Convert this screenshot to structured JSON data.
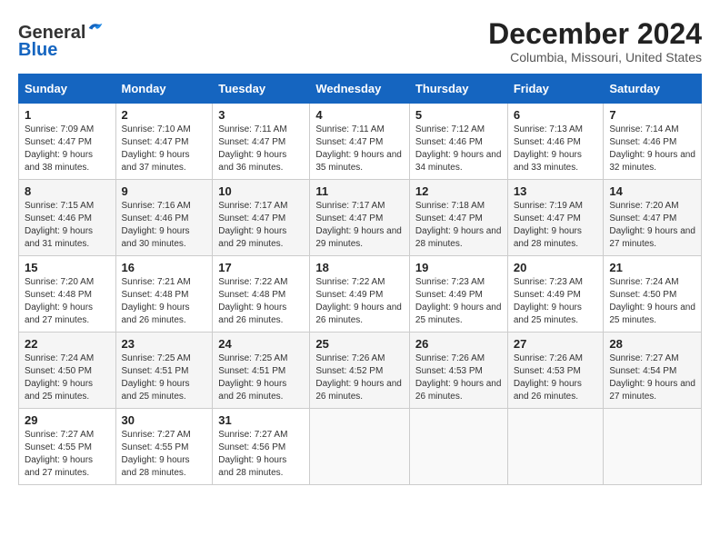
{
  "logo": {
    "line1": "General",
    "line2": "Blue"
  },
  "title": "December 2024",
  "subtitle": "Columbia, Missouri, United States",
  "weekdays": [
    "Sunday",
    "Monday",
    "Tuesday",
    "Wednesday",
    "Thursday",
    "Friday",
    "Saturday"
  ],
  "weeks": [
    [
      {
        "day": "1",
        "sunrise": "Sunrise: 7:09 AM",
        "sunset": "Sunset: 4:47 PM",
        "daylight": "Daylight: 9 hours and 38 minutes."
      },
      {
        "day": "2",
        "sunrise": "Sunrise: 7:10 AM",
        "sunset": "Sunset: 4:47 PM",
        "daylight": "Daylight: 9 hours and 37 minutes."
      },
      {
        "day": "3",
        "sunrise": "Sunrise: 7:11 AM",
        "sunset": "Sunset: 4:47 PM",
        "daylight": "Daylight: 9 hours and 36 minutes."
      },
      {
        "day": "4",
        "sunrise": "Sunrise: 7:11 AM",
        "sunset": "Sunset: 4:47 PM",
        "daylight": "Daylight: 9 hours and 35 minutes."
      },
      {
        "day": "5",
        "sunrise": "Sunrise: 7:12 AM",
        "sunset": "Sunset: 4:46 PM",
        "daylight": "Daylight: 9 hours and 34 minutes."
      },
      {
        "day": "6",
        "sunrise": "Sunrise: 7:13 AM",
        "sunset": "Sunset: 4:46 PM",
        "daylight": "Daylight: 9 hours and 33 minutes."
      },
      {
        "day": "7",
        "sunrise": "Sunrise: 7:14 AM",
        "sunset": "Sunset: 4:46 PM",
        "daylight": "Daylight: 9 hours and 32 minutes."
      }
    ],
    [
      {
        "day": "8",
        "sunrise": "Sunrise: 7:15 AM",
        "sunset": "Sunset: 4:46 PM",
        "daylight": "Daylight: 9 hours and 31 minutes."
      },
      {
        "day": "9",
        "sunrise": "Sunrise: 7:16 AM",
        "sunset": "Sunset: 4:46 PM",
        "daylight": "Daylight: 9 hours and 30 minutes."
      },
      {
        "day": "10",
        "sunrise": "Sunrise: 7:17 AM",
        "sunset": "Sunset: 4:47 PM",
        "daylight": "Daylight: 9 hours and 29 minutes."
      },
      {
        "day": "11",
        "sunrise": "Sunrise: 7:17 AM",
        "sunset": "Sunset: 4:47 PM",
        "daylight": "Daylight: 9 hours and 29 minutes."
      },
      {
        "day": "12",
        "sunrise": "Sunrise: 7:18 AM",
        "sunset": "Sunset: 4:47 PM",
        "daylight": "Daylight: 9 hours and 28 minutes."
      },
      {
        "day": "13",
        "sunrise": "Sunrise: 7:19 AM",
        "sunset": "Sunset: 4:47 PM",
        "daylight": "Daylight: 9 hours and 28 minutes."
      },
      {
        "day": "14",
        "sunrise": "Sunrise: 7:20 AM",
        "sunset": "Sunset: 4:47 PM",
        "daylight": "Daylight: 9 hours and 27 minutes."
      }
    ],
    [
      {
        "day": "15",
        "sunrise": "Sunrise: 7:20 AM",
        "sunset": "Sunset: 4:48 PM",
        "daylight": "Daylight: 9 hours and 27 minutes."
      },
      {
        "day": "16",
        "sunrise": "Sunrise: 7:21 AM",
        "sunset": "Sunset: 4:48 PM",
        "daylight": "Daylight: 9 hours and 26 minutes."
      },
      {
        "day": "17",
        "sunrise": "Sunrise: 7:22 AM",
        "sunset": "Sunset: 4:48 PM",
        "daylight": "Daylight: 9 hours and 26 minutes."
      },
      {
        "day": "18",
        "sunrise": "Sunrise: 7:22 AM",
        "sunset": "Sunset: 4:49 PM",
        "daylight": "Daylight: 9 hours and 26 minutes."
      },
      {
        "day": "19",
        "sunrise": "Sunrise: 7:23 AM",
        "sunset": "Sunset: 4:49 PM",
        "daylight": "Daylight: 9 hours and 25 minutes."
      },
      {
        "day": "20",
        "sunrise": "Sunrise: 7:23 AM",
        "sunset": "Sunset: 4:49 PM",
        "daylight": "Daylight: 9 hours and 25 minutes."
      },
      {
        "day": "21",
        "sunrise": "Sunrise: 7:24 AM",
        "sunset": "Sunset: 4:50 PM",
        "daylight": "Daylight: 9 hours and 25 minutes."
      }
    ],
    [
      {
        "day": "22",
        "sunrise": "Sunrise: 7:24 AM",
        "sunset": "Sunset: 4:50 PM",
        "daylight": "Daylight: 9 hours and 25 minutes."
      },
      {
        "day": "23",
        "sunrise": "Sunrise: 7:25 AM",
        "sunset": "Sunset: 4:51 PM",
        "daylight": "Daylight: 9 hours and 25 minutes."
      },
      {
        "day": "24",
        "sunrise": "Sunrise: 7:25 AM",
        "sunset": "Sunset: 4:51 PM",
        "daylight": "Daylight: 9 hours and 26 minutes."
      },
      {
        "day": "25",
        "sunrise": "Sunrise: 7:26 AM",
        "sunset": "Sunset: 4:52 PM",
        "daylight": "Daylight: 9 hours and 26 minutes."
      },
      {
        "day": "26",
        "sunrise": "Sunrise: 7:26 AM",
        "sunset": "Sunset: 4:53 PM",
        "daylight": "Daylight: 9 hours and 26 minutes."
      },
      {
        "day": "27",
        "sunrise": "Sunrise: 7:26 AM",
        "sunset": "Sunset: 4:53 PM",
        "daylight": "Daylight: 9 hours and 26 minutes."
      },
      {
        "day": "28",
        "sunrise": "Sunrise: 7:27 AM",
        "sunset": "Sunset: 4:54 PM",
        "daylight": "Daylight: 9 hours and 27 minutes."
      }
    ],
    [
      {
        "day": "29",
        "sunrise": "Sunrise: 7:27 AM",
        "sunset": "Sunset: 4:55 PM",
        "daylight": "Daylight: 9 hours and 27 minutes."
      },
      {
        "day": "30",
        "sunrise": "Sunrise: 7:27 AM",
        "sunset": "Sunset: 4:55 PM",
        "daylight": "Daylight: 9 hours and 28 minutes."
      },
      {
        "day": "31",
        "sunrise": "Sunrise: 7:27 AM",
        "sunset": "Sunset: 4:56 PM",
        "daylight": "Daylight: 9 hours and 28 minutes."
      },
      null,
      null,
      null,
      null
    ]
  ]
}
